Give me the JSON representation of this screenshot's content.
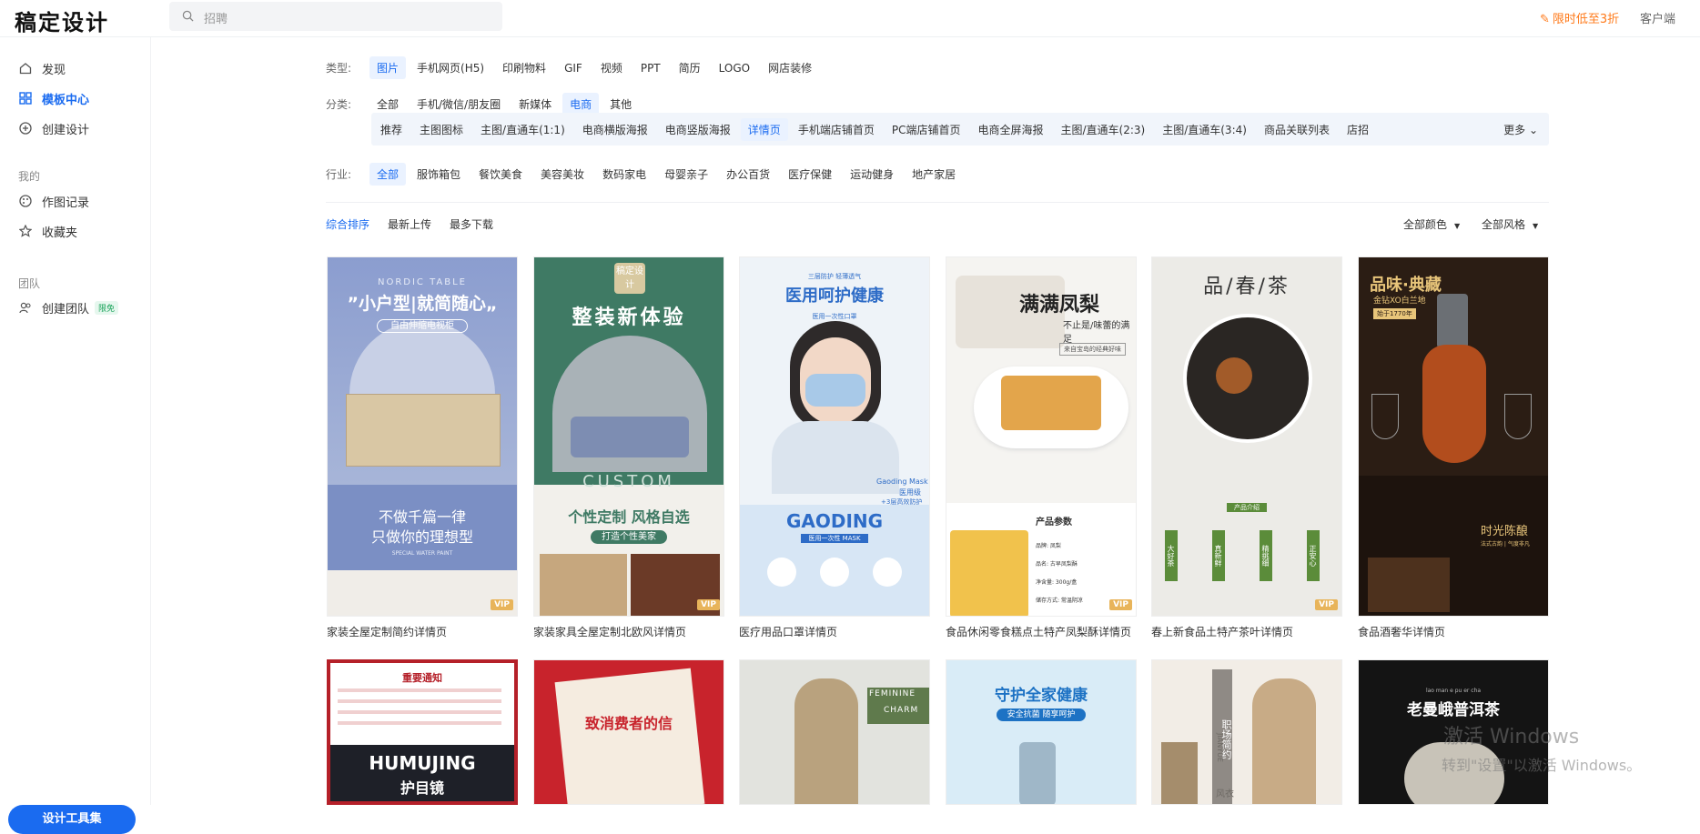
{
  "app": {
    "logo": "稿定设计"
  },
  "search": {
    "placeholder": "招聘"
  },
  "header": {
    "promo": "限时低至3折",
    "client": "客户端"
  },
  "sidebar": {
    "items": [
      {
        "label": "发现",
        "icon": "home-icon"
      },
      {
        "label": "模板中心",
        "icon": "grid-icon"
      },
      {
        "label": "创建设计",
        "icon": "plus-circle-icon"
      }
    ],
    "my_label": "我的",
    "my_items": [
      {
        "label": "作图记录",
        "icon": "palette-icon"
      },
      {
        "label": "收藏夹",
        "icon": "star-icon"
      }
    ],
    "team_label": "团队",
    "team_item": {
      "label": "创建团队",
      "badge": "限免",
      "icon": "team-icon"
    },
    "tool_button": "设计工具集"
  },
  "filters": {
    "type_label": "类型:",
    "types": [
      "图片",
      "手机网页(H5)",
      "印刷物料",
      "GIF",
      "视频",
      "PPT",
      "简历",
      "LOGO",
      "网店装修"
    ],
    "category_label": "分类:",
    "categories": [
      "全部",
      "手机/微信/朋友圈",
      "新媒体",
      "电商",
      "其他"
    ],
    "subcategories": [
      "推荐",
      "主图图标",
      "主图/直通车(1:1)",
      "电商横版海报",
      "电商竖版海报",
      "详情页",
      "手机端店铺首页",
      "PC端店铺首页",
      "电商全屏海报",
      "主图/直通车(2:3)",
      "主图/直通车(3:4)",
      "商品关联列表",
      "店招"
    ],
    "more": "更多",
    "industry_label": "行业:",
    "industries": [
      "全部",
      "服饰箱包",
      "餐饮美食",
      "美容美妆",
      "数码家电",
      "母婴亲子",
      "办公百货",
      "医疗保健",
      "运动健身",
      "地产家居"
    ]
  },
  "sort": {
    "options": [
      "综合排序",
      "最新上传",
      "最多下载"
    ],
    "color_filter": "全部颜色",
    "style_filter": "全部风格"
  },
  "templates": [
    {
      "title": "家装全屋定制简约详情页",
      "vip": "VIP",
      "t1": "NORDIC TABLE",
      "t2": "”小户型|就简随心„",
      "t3": "自由伸缩电视柜",
      "t4": "不做千篇一律",
      "t5": "只做你的理想型",
      "t6": "SPECIAL WATER PAINT"
    },
    {
      "title": "家装家具全屋定制北欧风详情页",
      "vip": "VIP",
      "t1": "稿定设计",
      "t2": "整装新体验",
      "t3": "CUSTOM",
      "t4": "个性定制 风格自选",
      "t5": "打造个性美家"
    },
    {
      "title": "医疗用品口罩详情页",
      "t1": "三层防护 轻薄透气",
      "t2": "医用呵护健康",
      "t3": "医用一次性口罩",
      "t4": "GAODING",
      "t5": "医用一次性 MASK",
      "t6": "Gaoding Mask",
      "t7": "医用级",
      "t8": "+3层高效防护"
    },
    {
      "title": "食品休闲零食糕点土特产凤梨酥详情页",
      "vip": "VIP",
      "t1": "满满凤梨",
      "t2": "不止是/味蕾的满足",
      "t3": "来自宝岛的经典好味",
      "t4": "产品参数",
      "t5": "品牌: 凤梨",
      "t6": "品名: 古早凤梨酥",
      "t7": "净含量: 300g/盒",
      "t8": "储存方式: 常温阴凉"
    },
    {
      "title": "春上新食品土特产茶叶详情页",
      "vip": "VIP",
      "t1": "品/春/茶",
      "t2": "产品介绍",
      "t3": "大好茶",
      "t4": "真新鲜",
      "t5": "精挑细",
      "t6": "正安心"
    },
    {
      "title": "食品酒奢华详情页",
      "t1": "品味·典藏",
      "t2": "金钻XO白兰地",
      "t3": "始于1770年",
      "t4": "时光陈酿",
      "t5": "法式古韵 | 气度非凡"
    },
    {
      "t1": "重要通知",
      "t2": "HUMUJING",
      "t3": "护目镜"
    },
    {
      "t1": "致消费者的信"
    },
    {
      "t1": "FEMININE",
      "t2": "CHARM"
    },
    {
      "t1": "守护全家健康",
      "t2": "安全抗菌 随享呵护"
    },
    {
      "t1": "职场简约",
      "t2": "JIANYUE",
      "t3": "风衣"
    },
    {
      "t1": "老曼峨普洱茶",
      "t2": "lao man e pu er cha"
    }
  ],
  "watermark": {
    "line1": "激活 Windows",
    "line2": "转到\"设置\"以激活 Windows。"
  },
  "colors": {
    "accent": "#1a6bf0",
    "promo": "#ff7a1a"
  }
}
